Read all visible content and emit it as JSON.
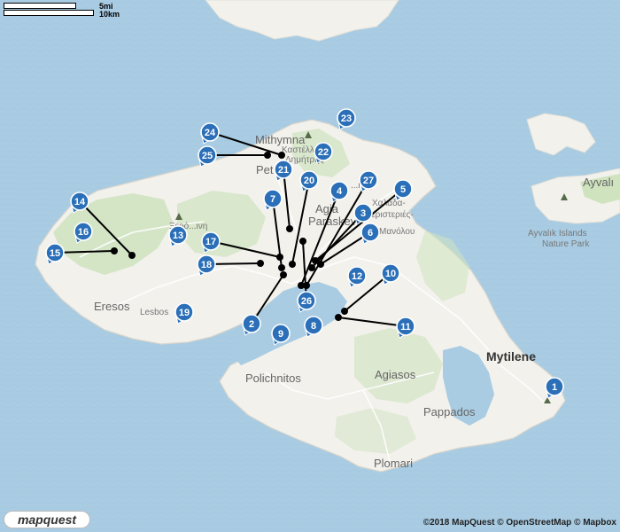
{
  "scale": {
    "miles": "5mi",
    "kilometers": "10km"
  },
  "places": {
    "mithymna": "Mithymna",
    "kastelli": "Καστέλλι",
    "dimitris": "Δημήτρης",
    "petra": "Pet",
    "agia_paraskevi_1": "Agia",
    "agia_paraskevi_2": "Paraskevi",
    "mandamados": "...naς",
    "chalkadas": "Χαλάδα-",
    "peristeries": "Περιστεριές-",
    "manolou": "Μανόλου",
    "xerokampos": "Ξερό...ινη",
    "eresos": "Eresos",
    "lesbos": "Lesbos",
    "polichnitos": "Polichnitos",
    "agiasos": "Agiasos",
    "pappados": "Pappados",
    "plomari": "Plomari",
    "mytilene": "Mytilene",
    "ayvalik": "Ayvalı",
    "ayvalik_islands_1": "Ayvalık Islands",
    "ayvalik_islands_2": "Nature Park"
  },
  "markers": [
    {
      "label": "1",
      "icon": "map-pin-icon"
    },
    {
      "label": "2",
      "icon": "map-pin-icon"
    },
    {
      "label": "3",
      "icon": "map-pin-icon"
    },
    {
      "label": "4",
      "icon": "map-pin-icon"
    },
    {
      "label": "5",
      "icon": "map-pin-icon"
    },
    {
      "label": "6",
      "icon": "map-pin-icon"
    },
    {
      "label": "7",
      "icon": "map-pin-icon"
    },
    {
      "label": "8",
      "icon": "map-pin-icon"
    },
    {
      "label": "9",
      "icon": "map-pin-icon"
    },
    {
      "label": "10",
      "icon": "map-pin-icon"
    },
    {
      "label": "11",
      "icon": "map-pin-icon"
    },
    {
      "label": "12",
      "icon": "map-pin-icon"
    },
    {
      "label": "13",
      "icon": "map-pin-icon"
    },
    {
      "label": "14",
      "icon": "map-pin-icon"
    },
    {
      "label": "15",
      "icon": "map-pin-icon"
    },
    {
      "label": "16",
      "icon": "map-pin-icon"
    },
    {
      "label": "17",
      "icon": "map-pin-icon"
    },
    {
      "label": "18",
      "icon": "map-pin-icon"
    },
    {
      "label": "19",
      "icon": "map-pin-icon"
    },
    {
      "label": "20",
      "icon": "map-pin-icon"
    },
    {
      "label": "21",
      "icon": "map-pin-icon"
    },
    {
      "label": "22",
      "icon": "map-pin-icon"
    },
    {
      "label": "23",
      "icon": "map-pin-icon"
    },
    {
      "label": "24",
      "icon": "map-pin-icon"
    },
    {
      "label": "25",
      "icon": "map-pin-icon"
    },
    {
      "label": "26",
      "icon": "map-pin-icon"
    },
    {
      "label": "27",
      "icon": "map-pin-icon"
    }
  ],
  "logo": "mapquest",
  "attribution": "©2018 MapQuest © OpenStreetMap © Mapbox",
  "colors": {
    "sea": "#a9cce3",
    "land": "#f2f1ec",
    "green": "#cfe3bf",
    "marker": "#2a6fb8",
    "line": "#000000"
  }
}
